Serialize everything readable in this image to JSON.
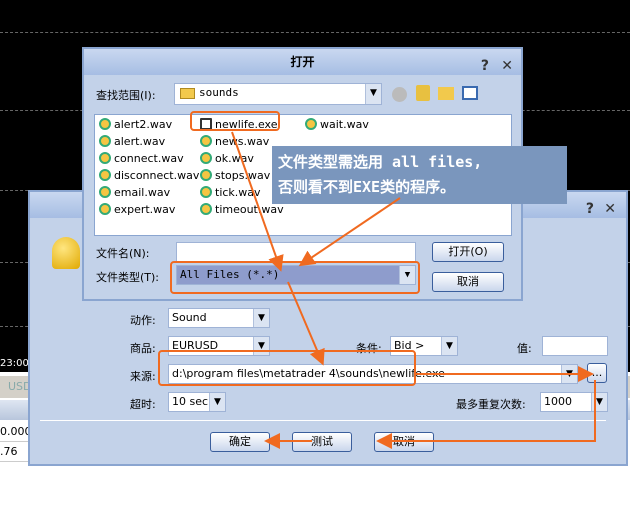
{
  "background": {
    "time_label": "23:00",
    "terminal_label": "USD",
    "rows": [
      "0.000",
      ".76"
    ]
  },
  "alert_dialog": {
    "action_label": "动作:",
    "action_value": "Sound",
    "symbol_label": "商品:",
    "symbol_value": "EURUSD",
    "condition_label": "条件:",
    "condition_value": "Bid >",
    "value_label": "值:",
    "value_value": "",
    "source_label": "来源:",
    "source_value": "d:\\program files\\metatrader 4\\sounds\\newlife.exe",
    "browse_label": "...",
    "timeout_label": "超时:",
    "timeout_value": "10 sec",
    "max_repeat_label": "最多重复次数:",
    "max_repeat_value": "1000",
    "ok": "确定",
    "test": "测试",
    "cancel": "取消"
  },
  "open_dialog": {
    "title": "打开",
    "help": "?",
    "close": "✕",
    "look_in_label": "查找范围(I):",
    "look_in_value": "sounds",
    "files_col1": [
      "alert2.wav",
      "alert.wav",
      "connect.wav",
      "disconnect.wav",
      "email.wav",
      "expert.wav"
    ],
    "files_col2": [
      "newlife.exe",
      "news.wav",
      "ok.wav",
      "stops.wav",
      "tick.wav",
      "timeout.wav"
    ],
    "files_col3": [
      "wait.wav"
    ],
    "filename_label": "文件名(N):",
    "filename_value": "",
    "filetype_label": "文件类型(T):",
    "filetype_value": "All Files (*.*)",
    "open_button": "打开(O)",
    "cancel_button": "取消"
  },
  "annotation": {
    "line1": "文件类型需选用 all files,",
    "line2": "否则看不到EXE类的程序。",
    "color": "#f06a20"
  }
}
